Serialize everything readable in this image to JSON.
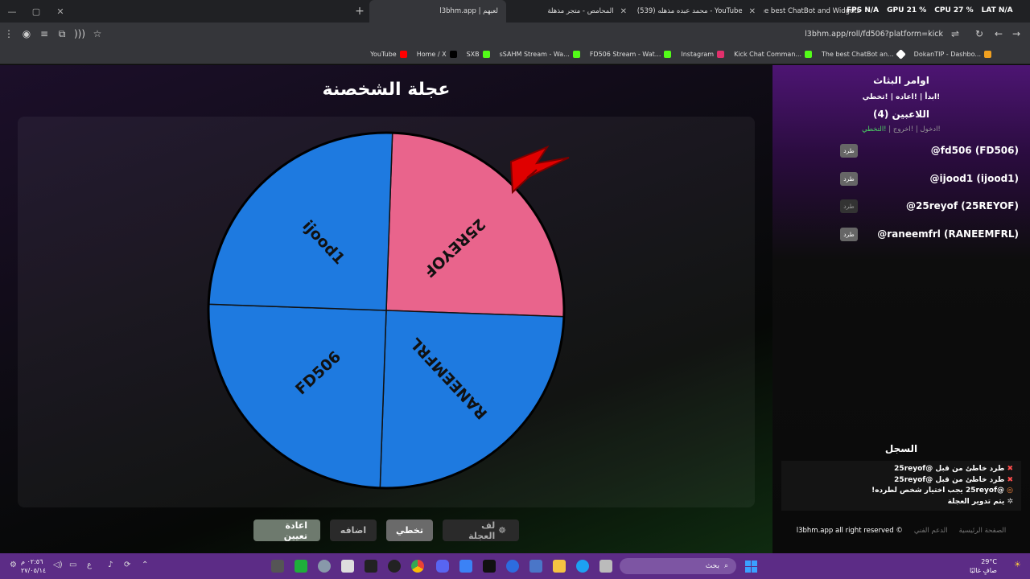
{
  "browser": {
    "stats": [
      "FPS N/A",
      "GPU 21 %",
      "CPU 27 %",
      "LAT N/A"
    ],
    "tabs": [
      {
        "title": "The best ChatBot and Widgets",
        "active": false
      },
      {
        "title": "(539) محمد عبده مذهله - YouTube",
        "active": false
      },
      {
        "title": "المحامص - متجر مذهلة",
        "active": false
      },
      {
        "title": "l3bhm.app | لعبهم",
        "active": true
      }
    ],
    "url": "l3bhm.app/roll/fd506?platform=kick",
    "bookmarks": [
      {
        "label": "YouTube",
        "color": "#ff0000"
      },
      {
        "label": "Home / X",
        "color": "#000000"
      },
      {
        "label": "SXB",
        "color": "#53fc18"
      },
      {
        "label": "sSAHM Stream - Wa...",
        "color": "#53fc18"
      },
      {
        "label": "FD506 Stream - Wat...",
        "color": "#53fc18"
      },
      {
        "label": "Instagram",
        "color": "#e1306c"
      },
      {
        "label": "Kick Chat Comman...",
        "color": "#53fc18"
      },
      {
        "label": "The best ChatBot an...",
        "color": "#ffffff"
      },
      {
        "label": "DokanTIP - Dashbo...",
        "color": "#f0a020"
      }
    ]
  },
  "main": {
    "title": "عجلة الشخصنة",
    "wheel": {
      "segments": [
        {
          "label": "25REYOF",
          "color": "#e9648c"
        },
        {
          "label": "RANEEMFRL",
          "color": "#1e7ae0"
        },
        {
          "label": "FD506",
          "color": "#1e7ae0"
        },
        {
          "label": "ijood1",
          "color": "#1e7ae0"
        }
      ]
    },
    "controls": {
      "spin": "لف العجلة",
      "skip": "تخطي",
      "add": "اضافه",
      "reset": "اعادة تعيين"
    }
  },
  "sidebar": {
    "commands_title": "اوامر البثاث",
    "commands_sub": "!ابدأ | !اعاده | !تخطي",
    "players_title": "اللاعبين (4)",
    "player_actions": {
      "join": "!ادخول",
      "sep": " | ",
      "leave": "!اخروج",
      "skip": "!التخطي"
    },
    "players": [
      {
        "name": "@fd506 (FD506)",
        "kick": "طرد",
        "dim": false
      },
      {
        "name": "@ijood1 (ijood1)",
        "kick": "طرد",
        "dim": false
      },
      {
        "name": "@25reyof (25REYOF)",
        "kick": "طرد",
        "dim": true
      },
      {
        "name": "@raneemfrl (RANEEMFRL)",
        "kick": "طرد",
        "dim": false
      }
    ],
    "log_title": "السجل",
    "log": [
      {
        "icon": "✖",
        "color": "#ff4d4d",
        "text": "طرد خاطئ من قبل @25reyof"
      },
      {
        "icon": "✖",
        "color": "#ff4d4d",
        "text": "طرد خاطئ من قبل @25reyof"
      },
      {
        "icon": "◎",
        "color": "#ff8a3d",
        "text": "@25reyof يجب اختيار شخص لطرده!"
      },
      {
        "icon": "✲",
        "color": "#cfcfcf",
        "text": "يتم تدوير العجلة"
      }
    ],
    "footer": {
      "home": "الصفحة الرئيسية",
      "support": "الدعم الفني",
      "rights": "l3bhm.app all right reserved ©"
    }
  },
  "taskbar": {
    "search": "بحث",
    "weather": {
      "temp": "29°C",
      "desc": "صافٍ غالبًا"
    },
    "clock": {
      "time": "٠٢:٥٦ م",
      "date": "٢٧/٠٥/١٤"
    },
    "lang": "ع"
  }
}
